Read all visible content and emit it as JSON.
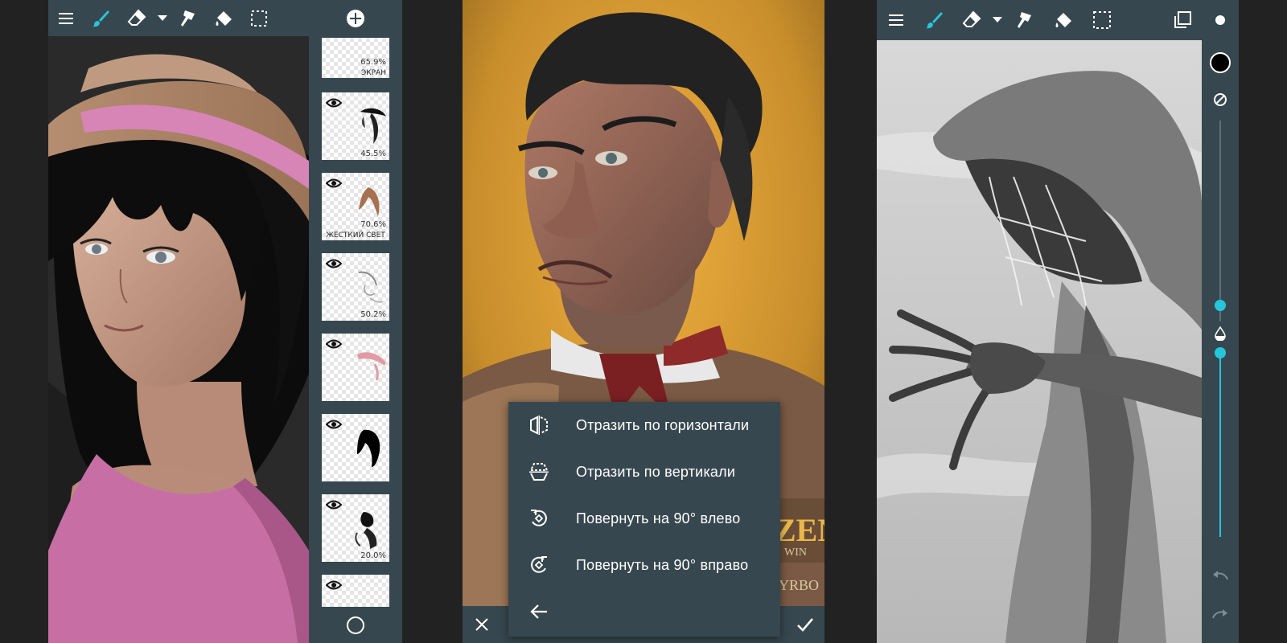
{
  "colors": {
    "toolbar": "#37474f",
    "accent": "#26c6da",
    "background": "#222222"
  },
  "panel1": {
    "toolbar_icons": [
      "menu-icon",
      "brush-icon",
      "eraser-icon",
      "dropdown-icon",
      "smudge-icon",
      "fill-icon",
      "selection-icon"
    ],
    "add_layer_icon": "plus-circle-icon",
    "layers": [
      {
        "opacity": "65.9%",
        "blend": "ЭКРАН"
      },
      {
        "opacity": "45.5%",
        "blend": ""
      },
      {
        "opacity": "70.6%",
        "blend": "ЖЕСТКИЙ СВЕТ"
      },
      {
        "opacity": "50.2%",
        "blend": ""
      },
      {
        "opacity": "",
        "blend": ""
      },
      {
        "opacity": "",
        "blend": ""
      },
      {
        "opacity": "20.0%",
        "blend": ""
      },
      {
        "opacity": "",
        "blend": ""
      }
    ]
  },
  "panel2": {
    "menu": {
      "items": [
        {
          "label": "Отразить по горизонтали",
          "icon": "flip-horizontal-icon"
        },
        {
          "label": "Отразить по вертикали",
          "icon": "flip-vertical-icon"
        },
        {
          "label": "Повернуть на 90° влево",
          "icon": "rotate-left-icon"
        },
        {
          "label": "Повернуть на 90° вправо",
          "icon": "rotate-right-icon"
        }
      ],
      "back_icon": "back-arrow-icon"
    },
    "cancel_icon": "close-icon",
    "confirm_icon": "check-icon",
    "logo_partial": {
      "line1": "ZEN",
      "line2": "WIN",
      "line3": "HYRBO"
    }
  },
  "panel3": {
    "toolbar_icons": [
      "menu-icon",
      "brush-icon",
      "eraser-icon",
      "dropdown-icon",
      "smudge-icon",
      "fill-icon",
      "selection-icon",
      "layers-icon",
      "brush-size-icon"
    ],
    "side_icons": [
      "color-swatch-icon",
      "no-color-icon",
      "opacity-icon",
      "undo-icon",
      "redo-icon"
    ],
    "brush_size_level": 0.45,
    "opacity_level": 0.44
  }
}
